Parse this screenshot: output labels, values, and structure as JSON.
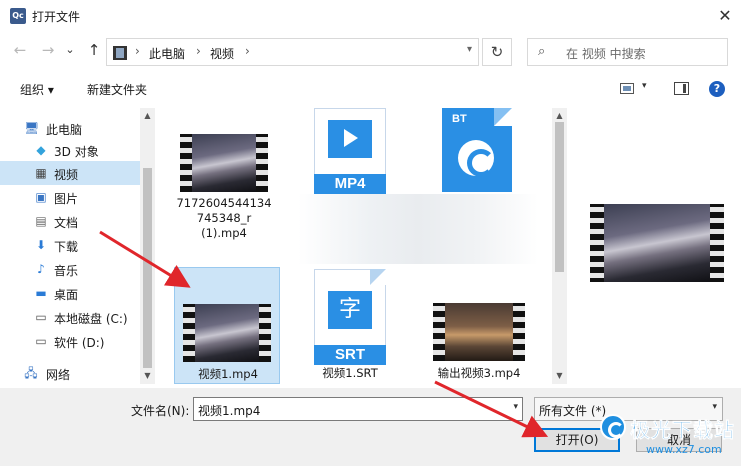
{
  "window": {
    "app_icon_text": "Qc",
    "title": "打开文件",
    "close_glyph": "✕"
  },
  "nav": {
    "back_glyph": "←",
    "forward_glyph": "→",
    "history_glyph": "⌄",
    "up_glyph": "↑",
    "breadcrumbs": [
      "此电脑",
      "视频"
    ],
    "breadcrumb_sep": "›",
    "refresh_glyph": "↻",
    "search_placeholder": "在 视频 中搜索",
    "search_icon": "search-icon"
  },
  "toolbar": {
    "organize_label": "组织 ▾",
    "new_folder_label": "新建文件夹",
    "help_glyph": "?"
  },
  "sidebar": {
    "items": [
      {
        "label": "此电脑",
        "icon": "pc-icon",
        "glyph": "🖥",
        "selected": false
      },
      {
        "label": "3D 对象",
        "icon": "3d-objects-icon",
        "glyph": "◆",
        "selected": false
      },
      {
        "label": "视频",
        "icon": "video-folder-icon",
        "glyph": "▦",
        "selected": true
      },
      {
        "label": "图片",
        "icon": "pictures-icon",
        "glyph": "▣",
        "selected": false
      },
      {
        "label": "文档",
        "icon": "documents-icon",
        "glyph": "▤",
        "selected": false
      },
      {
        "label": "下载",
        "icon": "download-icon",
        "glyph": "⬇",
        "selected": false
      },
      {
        "label": "音乐",
        "icon": "music-icon",
        "glyph": "♪",
        "selected": false
      },
      {
        "label": "桌面",
        "icon": "desktop-icon",
        "glyph": "▬",
        "selected": false
      },
      {
        "label": "本地磁盘 (C:)",
        "icon": "drive-c-icon",
        "glyph": "▭",
        "selected": false
      },
      {
        "label": "软件 (D:)",
        "icon": "drive-d-icon",
        "glyph": "▭",
        "selected": false
      },
      {
        "label": "网络",
        "icon": "network-icon",
        "glyph": "🖧",
        "selected": false
      }
    ]
  },
  "files": [
    {
      "name_lines": [
        "7172604544134",
        "745348_r",
        "(1).mp4"
      ],
      "kind": "video",
      "selected": false
    },
    {
      "name_lines": [
        "MP4"
      ],
      "kind": "mp4-doc",
      "selected": false
    },
    {
      "name_lines": [
        "BT"
      ],
      "kind": "bt-doc",
      "selected": false
    },
    {
      "name_lines": [
        "视频1.mp4"
      ],
      "kind": "video",
      "selected": true
    },
    {
      "name_lines": [
        "视频1.SRT"
      ],
      "kind": "srt-doc",
      "badge": "SRT",
      "glyph": "字",
      "selected": false
    },
    {
      "name_lines": [
        "输出视频3.mp4"
      ],
      "kind": "video-warm",
      "selected": false
    }
  ],
  "footer": {
    "filename_label": "文件名(N):",
    "filename_value": "视频1.mp4",
    "filetype_value": "所有文件 (*)",
    "open_label": "打开(O)",
    "cancel_label": "取消",
    "dropdown_glyph": "▾"
  },
  "watermark": {
    "text": "极光下载站",
    "url": "www.xz7.com"
  },
  "colors": {
    "selection": "#cce4f7",
    "accent": "#2a8fe4",
    "arrow": "#e0262b"
  }
}
